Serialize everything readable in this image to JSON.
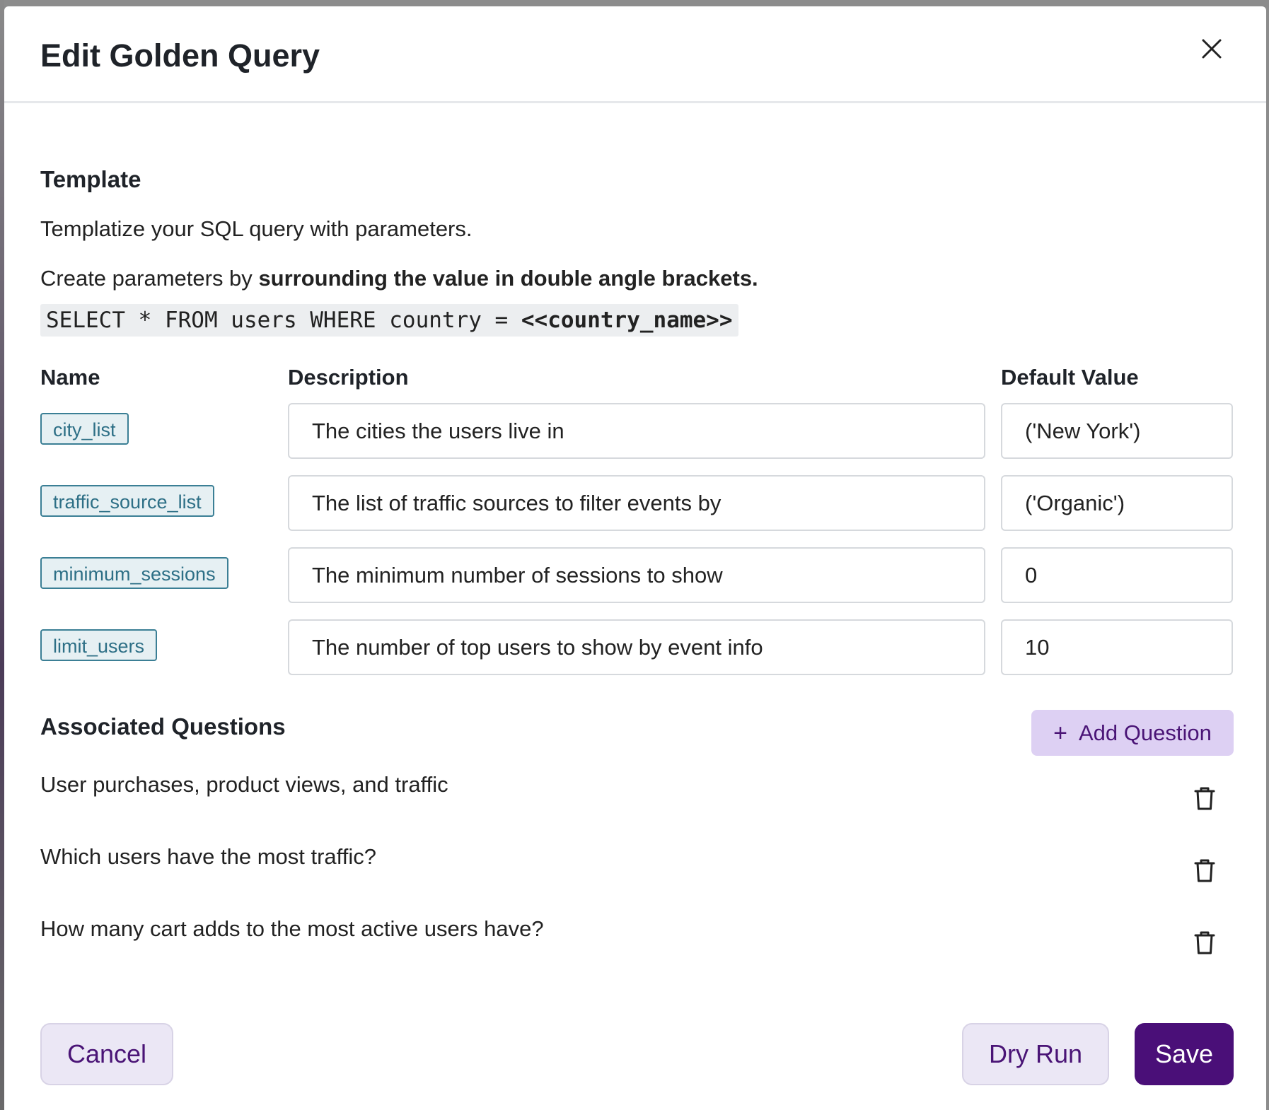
{
  "dialog": {
    "title": "Edit Golden Query"
  },
  "template": {
    "heading": "Template",
    "intro": "Templatize your SQL query with parameters.",
    "instruction_prefix": "Create parameters by",
    "instruction_bold": "surrounding the value in double angle brackets.",
    "code_prefix": "SELECT * FROM users WHERE country = ",
    "code_param": "<<country_name>>"
  },
  "params_table": {
    "headers": {
      "name": "Name",
      "description": "Description",
      "default": "Default Value"
    },
    "rows": [
      {
        "name": "city_list",
        "description": "The cities the users live in",
        "default": "('New York')"
      },
      {
        "name": "traffic_source_list",
        "description": "The list of traffic sources to filter events by",
        "default": "('Organic')"
      },
      {
        "name": "minimum_sessions",
        "description": "The minimum number of sessions to show",
        "default": "0"
      },
      {
        "name": "limit_users",
        "description": "The number of top users to show by event info",
        "default": "10"
      }
    ]
  },
  "questions": {
    "heading": "Associated Questions",
    "add_label": "Add Question",
    "items": [
      "User purchases, product views, and traffic",
      "Which users have the most traffic?",
      "How many cart adds to the most active users have?"
    ]
  },
  "footer": {
    "cancel": "Cancel",
    "dry_run": "Dry Run",
    "save": "Save"
  },
  "colors": {
    "primary": "#4a0f78",
    "tag_border": "#3b7f95",
    "add_button_bg": "#ddd0f3"
  }
}
